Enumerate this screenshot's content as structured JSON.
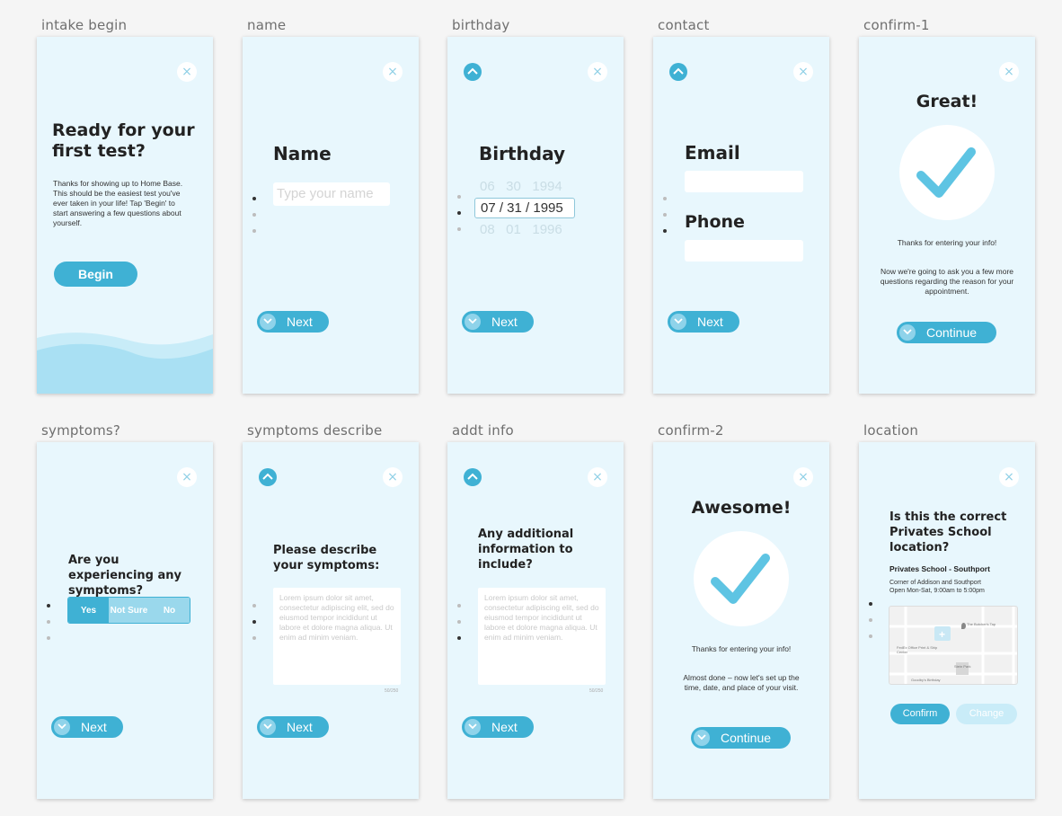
{
  "labels": [
    "intake begin",
    "name",
    "birthday",
    "contact",
    "confirm-1",
    "symptoms?",
    "symptoms describe",
    "addt info",
    "confirm-2",
    "location"
  ],
  "close_glyph": "×",
  "intake": {
    "title_line1": "Ready for your",
    "title_line2": "first test?",
    "body": "Thanks for showing up to Home Base. This should be the easiest test you've ever taken in your life! Tap 'Begin' to start answering a few questions about yourself.",
    "button": "Begin"
  },
  "name": {
    "title": "Name",
    "placeholder": "Type your name",
    "button": "Next"
  },
  "birthday": {
    "title": "Birthday",
    "row_prev": "06   30   1994",
    "row_selected": "07 / 31 / 1995",
    "row_next": "08   01   1996",
    "button": "Next"
  },
  "contact": {
    "email_label": "Email",
    "phone_label": "Phone",
    "button": "Next"
  },
  "confirm1": {
    "title": "Great!",
    "line1": "Thanks for entering your info!",
    "line2": "Now we're going to ask you a few more questions regarding the reason for your appointment.",
    "button": "Continue"
  },
  "symptoms": {
    "question": "Are you experiencing any symptoms?",
    "opt_yes": "Yes",
    "opt_notsure": "Not Sure",
    "opt_no": "No",
    "button": "Next"
  },
  "describe": {
    "title": "Please describe your symptoms:",
    "text": "Lorem ipsum dolor sit amet, consectetur adipiscing elit, sed do eiusmod tempor incididunt ut labore et dolore magna aliqua. Ut enim ad minim veniam.",
    "counter": "50/250",
    "button": "Next"
  },
  "addt": {
    "title": "Any additional information to include?",
    "text": "Lorem ipsum dolor sit amet, consectetur adipiscing elit, sed do eiusmod tempor incididunt ut labore et dolore magna aliqua. Ut enim ad minim veniam.",
    "counter": "50/250",
    "button": "Next"
  },
  "confirm2": {
    "title": "Awesome!",
    "line1": "Thanks for entering your info!",
    "line2": "Almost done – now let's set up the time, date, and place of your visit.",
    "button": "Continue"
  },
  "location": {
    "title": "Is this the correct Privates School location?",
    "name": "Privates School - Southport",
    "addr1": "Corner of Addison and Southport",
    "addr2": "Open Mon-Sat, 9:00am to 5:00pm",
    "map_label1": "The Butcher's Tap",
    "map_label2": "FedEx Office Print & Ship Center",
    "map_label3": "Stein Park",
    "map_label4": "Goodby's Birthday",
    "confirm": "Confirm",
    "change": "Change"
  },
  "colors": {
    "accent": "#3fb1d4",
    "screen_bg": "#e8f7fd",
    "check": "#5ec4e3",
    "disabled": "#c9ecf8"
  }
}
